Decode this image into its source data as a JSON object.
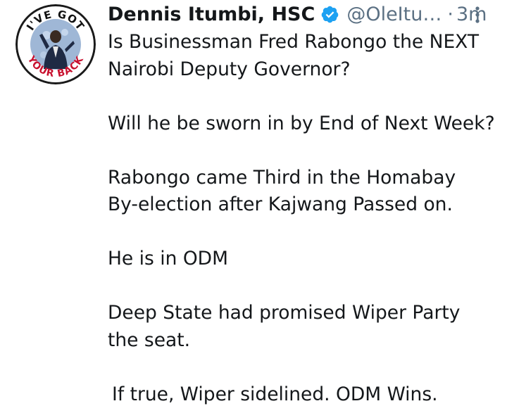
{
  "author": {
    "name": "Dennis Itumbi, HSC",
    "handle": "@OleItu…",
    "separator": "·",
    "time": "3m",
    "avatar_text_top": "I'VE GOT",
    "avatar_text_bottom": "YOUR BACK"
  },
  "icons": {
    "verified": "verified-badge-icon",
    "more": "more-vertical-icon"
  },
  "colors": {
    "verified": "#1da1f2",
    "secondary_text": "#5b7083",
    "primary_text": "#14171a"
  },
  "tweet": {
    "p1_line1": "Is Businessman Fred Rabongo  the NEXT",
    "p1_line2": "Nairobi Deputy Governor?",
    "p2": "Will he be sworn in by End of Next Week?",
    "p3_line1": "Rabongo came Third in the Homabay",
    "p3_line2": "By-election after Kajwang Passed on.",
    "p4": "He is in ODM",
    "p5_line1": "Deep State had promised Wiper Party",
    "p5_line2": "the seat.",
    "p6": "If true, Wiper sidelined. ODM Wins."
  }
}
